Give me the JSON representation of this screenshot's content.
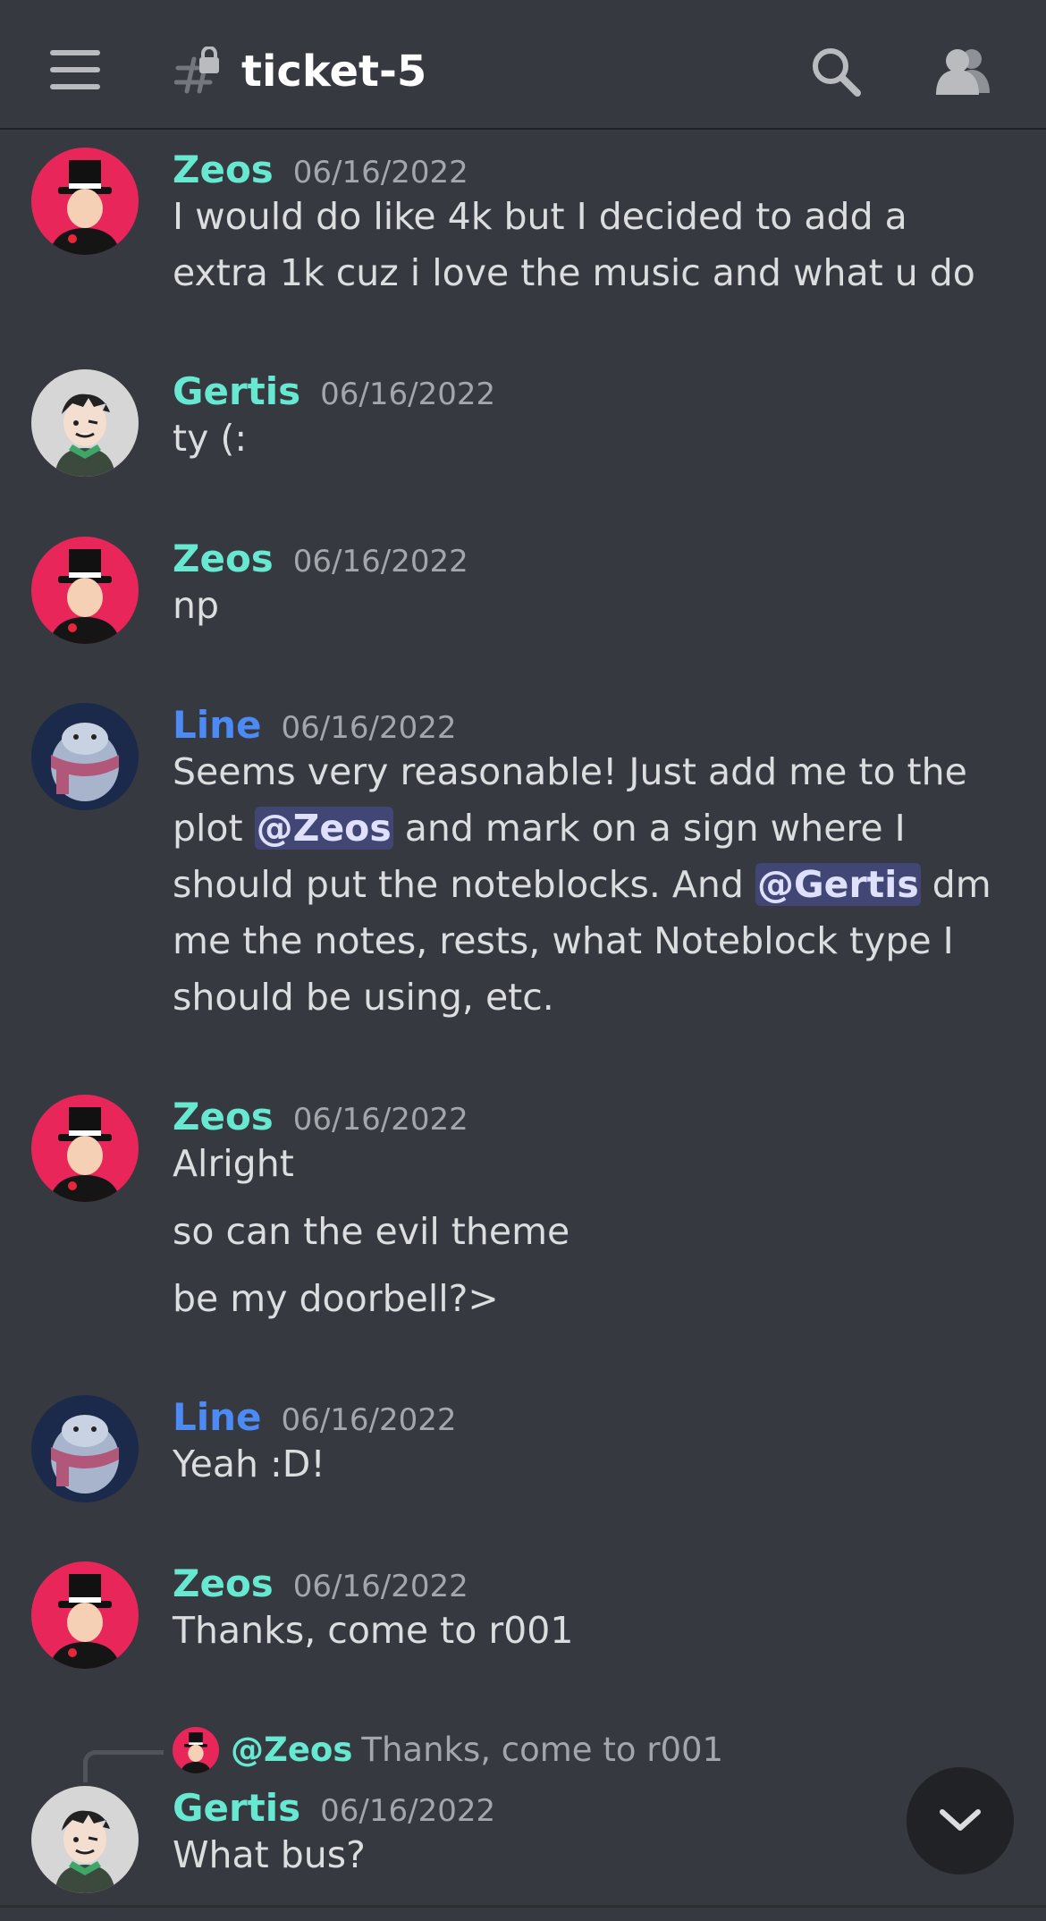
{
  "header": {
    "channel_name": "ticket-5",
    "menu_icon": "hamburger-menu-icon",
    "channel_icon": "locked-hash-icon",
    "search_icon": "search-icon",
    "members_icon": "members-icon"
  },
  "messages": [
    {
      "author": "Zeos",
      "time": "06/16/2022",
      "lines": [
        "I would do like 4k but I decided to add a extra 1k cuz i love the music and what u do"
      ]
    },
    {
      "author": "Gertis",
      "time": "06/16/2022",
      "lines": [
        "ty (:"
      ]
    },
    {
      "author": "Zeos",
      "time": "06/16/2022",
      "lines": [
        "np"
      ]
    },
    {
      "author": "Line",
      "time": "06/16/2022",
      "parts": [
        "Seems very reasonable! Just add me to the plot ",
        "@Zeos",
        " and mark on a sign where I should put the noteblocks. And ",
        "@Gertis",
        " dm me the notes, rests, what Noteblock type I should be using, etc."
      ]
    },
    {
      "author": "Zeos",
      "time": "06/16/2022",
      "lines": [
        "Alright",
        "so can the evil theme",
        "be my doorbell?>"
      ]
    },
    {
      "author": "Line",
      "time": "06/16/2022",
      "lines": [
        "Yeah :D!"
      ]
    },
    {
      "author": "Zeos",
      "time": "06/16/2022",
      "lines": [
        "Thanks, come to r001"
      ]
    },
    {
      "author": "Gertis",
      "time": "06/16/2022",
      "lines": [
        "What bus?"
      ],
      "reply": {
        "author": "@Zeos",
        "content": "Thanks, come to r001"
      }
    }
  ],
  "scroll_icon": "chevron-down-icon",
  "colors": {
    "background": "#36393f",
    "author": "#67e8d1",
    "author_line": "#4c8bf5",
    "mention_bg": "#414675"
  }
}
